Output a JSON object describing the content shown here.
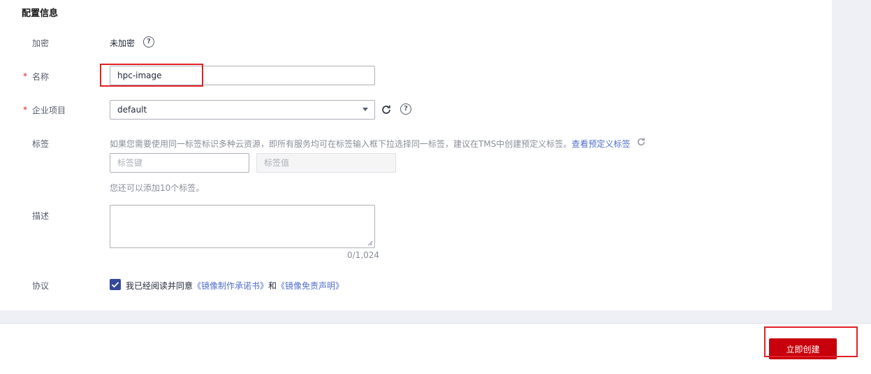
{
  "section": {
    "title": "配置信息"
  },
  "encryption": {
    "label": "加密",
    "value": "未加密",
    "help_icon": "question-circle-icon"
  },
  "name": {
    "required_mark": "*",
    "label": "名称",
    "value": "hpc-image"
  },
  "enterprise_project": {
    "required_mark": "*",
    "label": "企业项目",
    "selected": "default",
    "refresh_icon": "refresh-icon",
    "help_icon": "question-circle-icon"
  },
  "tags": {
    "label": "标签",
    "hint": "如果您需要使用同一标签标识多种云资源，即所有服务均可在标签输入框下拉选择同一标签，建议在TMS中创建预定义标签。",
    "predefined_link": "查看预定义标签",
    "key_placeholder": "标签键",
    "value_placeholder": "标签值",
    "remaining": "您还可以添加10个标签。"
  },
  "description": {
    "label": "描述",
    "counter": "0/1,024"
  },
  "agreement": {
    "label": "协议",
    "checked": true,
    "text_prefix": "我已经阅读并同意",
    "link1": "《镜像制作承诺书》",
    "joiner": "和",
    "link2": "《镜像免责声明》"
  },
  "footer": {
    "create_button": "立即创建"
  },
  "colors": {
    "primary_button": "#c7000b",
    "highlight": "#e02128",
    "link": "#526ecc",
    "checkbox": "#344899"
  }
}
